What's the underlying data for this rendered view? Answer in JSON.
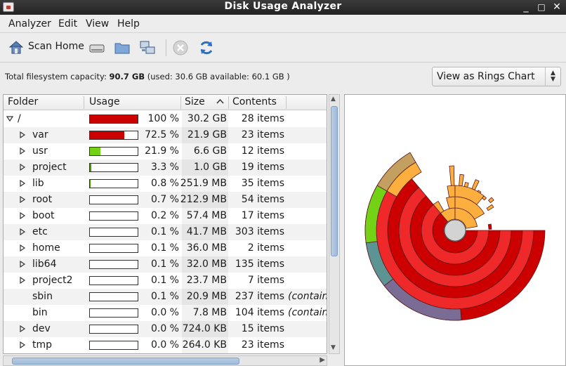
{
  "window": {
    "title": "Disk Usage Analyzer",
    "min": "_",
    "max": "□",
    "close": "✕"
  },
  "menu": [
    "Analyzer",
    "Edit",
    "View",
    "Help"
  ],
  "toolbar": {
    "scan_home": "Scan Home"
  },
  "info": {
    "prefix": "Total filesystem capacity: ",
    "capacity": "90.7 GB",
    "suffix": " (used: 30.6 GB available: 60.1 GB )"
  },
  "view_select": {
    "label": "View as Rings Chart"
  },
  "columns": {
    "folder": "Folder",
    "usage": "Usage",
    "size": "Size",
    "contents": "Contents"
  },
  "rows": [
    {
      "name": "/",
      "pct": "100 %",
      "usage": 1.0,
      "size": "30.2 GB",
      "items": "28 items",
      "note": "",
      "expander": "open",
      "color": "#cc0000",
      "level": 0
    },
    {
      "name": "var",
      "pct": "72.5 %",
      "usage": 0.725,
      "size": "21.9 GB",
      "items": "23 items",
      "note": "",
      "expander": "closed",
      "color": "#cc0000",
      "level": 1
    },
    {
      "name": "usr",
      "pct": "21.9 %",
      "usage": 0.219,
      "size": "6.6 GB",
      "items": "12 items",
      "note": "",
      "expander": "closed",
      "color": "#73d216",
      "level": 1
    },
    {
      "name": "project",
      "pct": "3.3 %",
      "usage": 0.033,
      "size": "1.0 GB",
      "items": "19 items",
      "note": "",
      "expander": "closed",
      "color": "#4e9a06",
      "level": 1
    },
    {
      "name": "lib",
      "pct": "0.8 %",
      "usage": 0.008,
      "size": "251.9 MB",
      "items": "35 items",
      "note": "",
      "expander": "closed",
      "color": "#4e9a06",
      "level": 1
    },
    {
      "name": "root",
      "pct": "0.7 %",
      "usage": 0.007,
      "size": "212.9 MB",
      "items": "54 items",
      "note": "",
      "expander": "closed",
      "color": "#4e9a06",
      "level": 1
    },
    {
      "name": "boot",
      "pct": "0.2 %",
      "usage": 0.002,
      "size": "57.4 MB",
      "items": "17 items",
      "note": "",
      "expander": "closed",
      "color": "#4e9a06",
      "level": 1
    },
    {
      "name": "etc",
      "pct": "0.1 %",
      "usage": 0.001,
      "size": "41.7 MB",
      "items": "303 items",
      "note": "",
      "expander": "closed",
      "color": "#4e9a06",
      "level": 1
    },
    {
      "name": "home",
      "pct": "0.1 %",
      "usage": 0.001,
      "size": "36.0 MB",
      "items": "2 items",
      "note": "",
      "expander": "closed",
      "color": "#4e9a06",
      "level": 1
    },
    {
      "name": "lib64",
      "pct": "0.1 %",
      "usage": 0.001,
      "size": "32.0 MB",
      "items": "135 items",
      "note": "",
      "expander": "closed",
      "color": "#4e9a06",
      "level": 1
    },
    {
      "name": "project2",
      "pct": "0.1 %",
      "usage": 0.001,
      "size": "23.7 MB",
      "items": "7 items",
      "note": "",
      "expander": "closed",
      "color": "#4e9a06",
      "level": 1
    },
    {
      "name": "sbin",
      "pct": "0.1 %",
      "usage": 0.001,
      "size": "20.9 MB",
      "items": "237 items",
      "note": "(contain",
      "expander": "none",
      "color": "#4e9a06",
      "level": 1
    },
    {
      "name": "bin",
      "pct": "0.0 %",
      "usage": 0.0,
      "size": "7.8 MB",
      "items": "104 items",
      "note": "(contain",
      "expander": "none",
      "color": "#4e9a06",
      "level": 1
    },
    {
      "name": "dev",
      "pct": "0.0 %",
      "usage": 0.0,
      "size": "724.0 KB",
      "items": "15 items",
      "note": "",
      "expander": "closed",
      "color": "#4e9a06",
      "level": 1
    },
    {
      "name": "tmp",
      "pct": "0.0 %",
      "usage": 0.0,
      "size": "264.0 KB",
      "items": "23 items",
      "note": "",
      "expander": "closed",
      "color": "#4e9a06",
      "level": 1
    }
  ],
  "ring_colors": {
    "red": "#ef2929",
    "red_dark": "#cc0000",
    "orange": "#fcaf3e",
    "tan": "#c4a060",
    "green": "#73d216",
    "teal": "#5c9393",
    "purple": "#7b6c96",
    "center": "#d3d3d3"
  }
}
